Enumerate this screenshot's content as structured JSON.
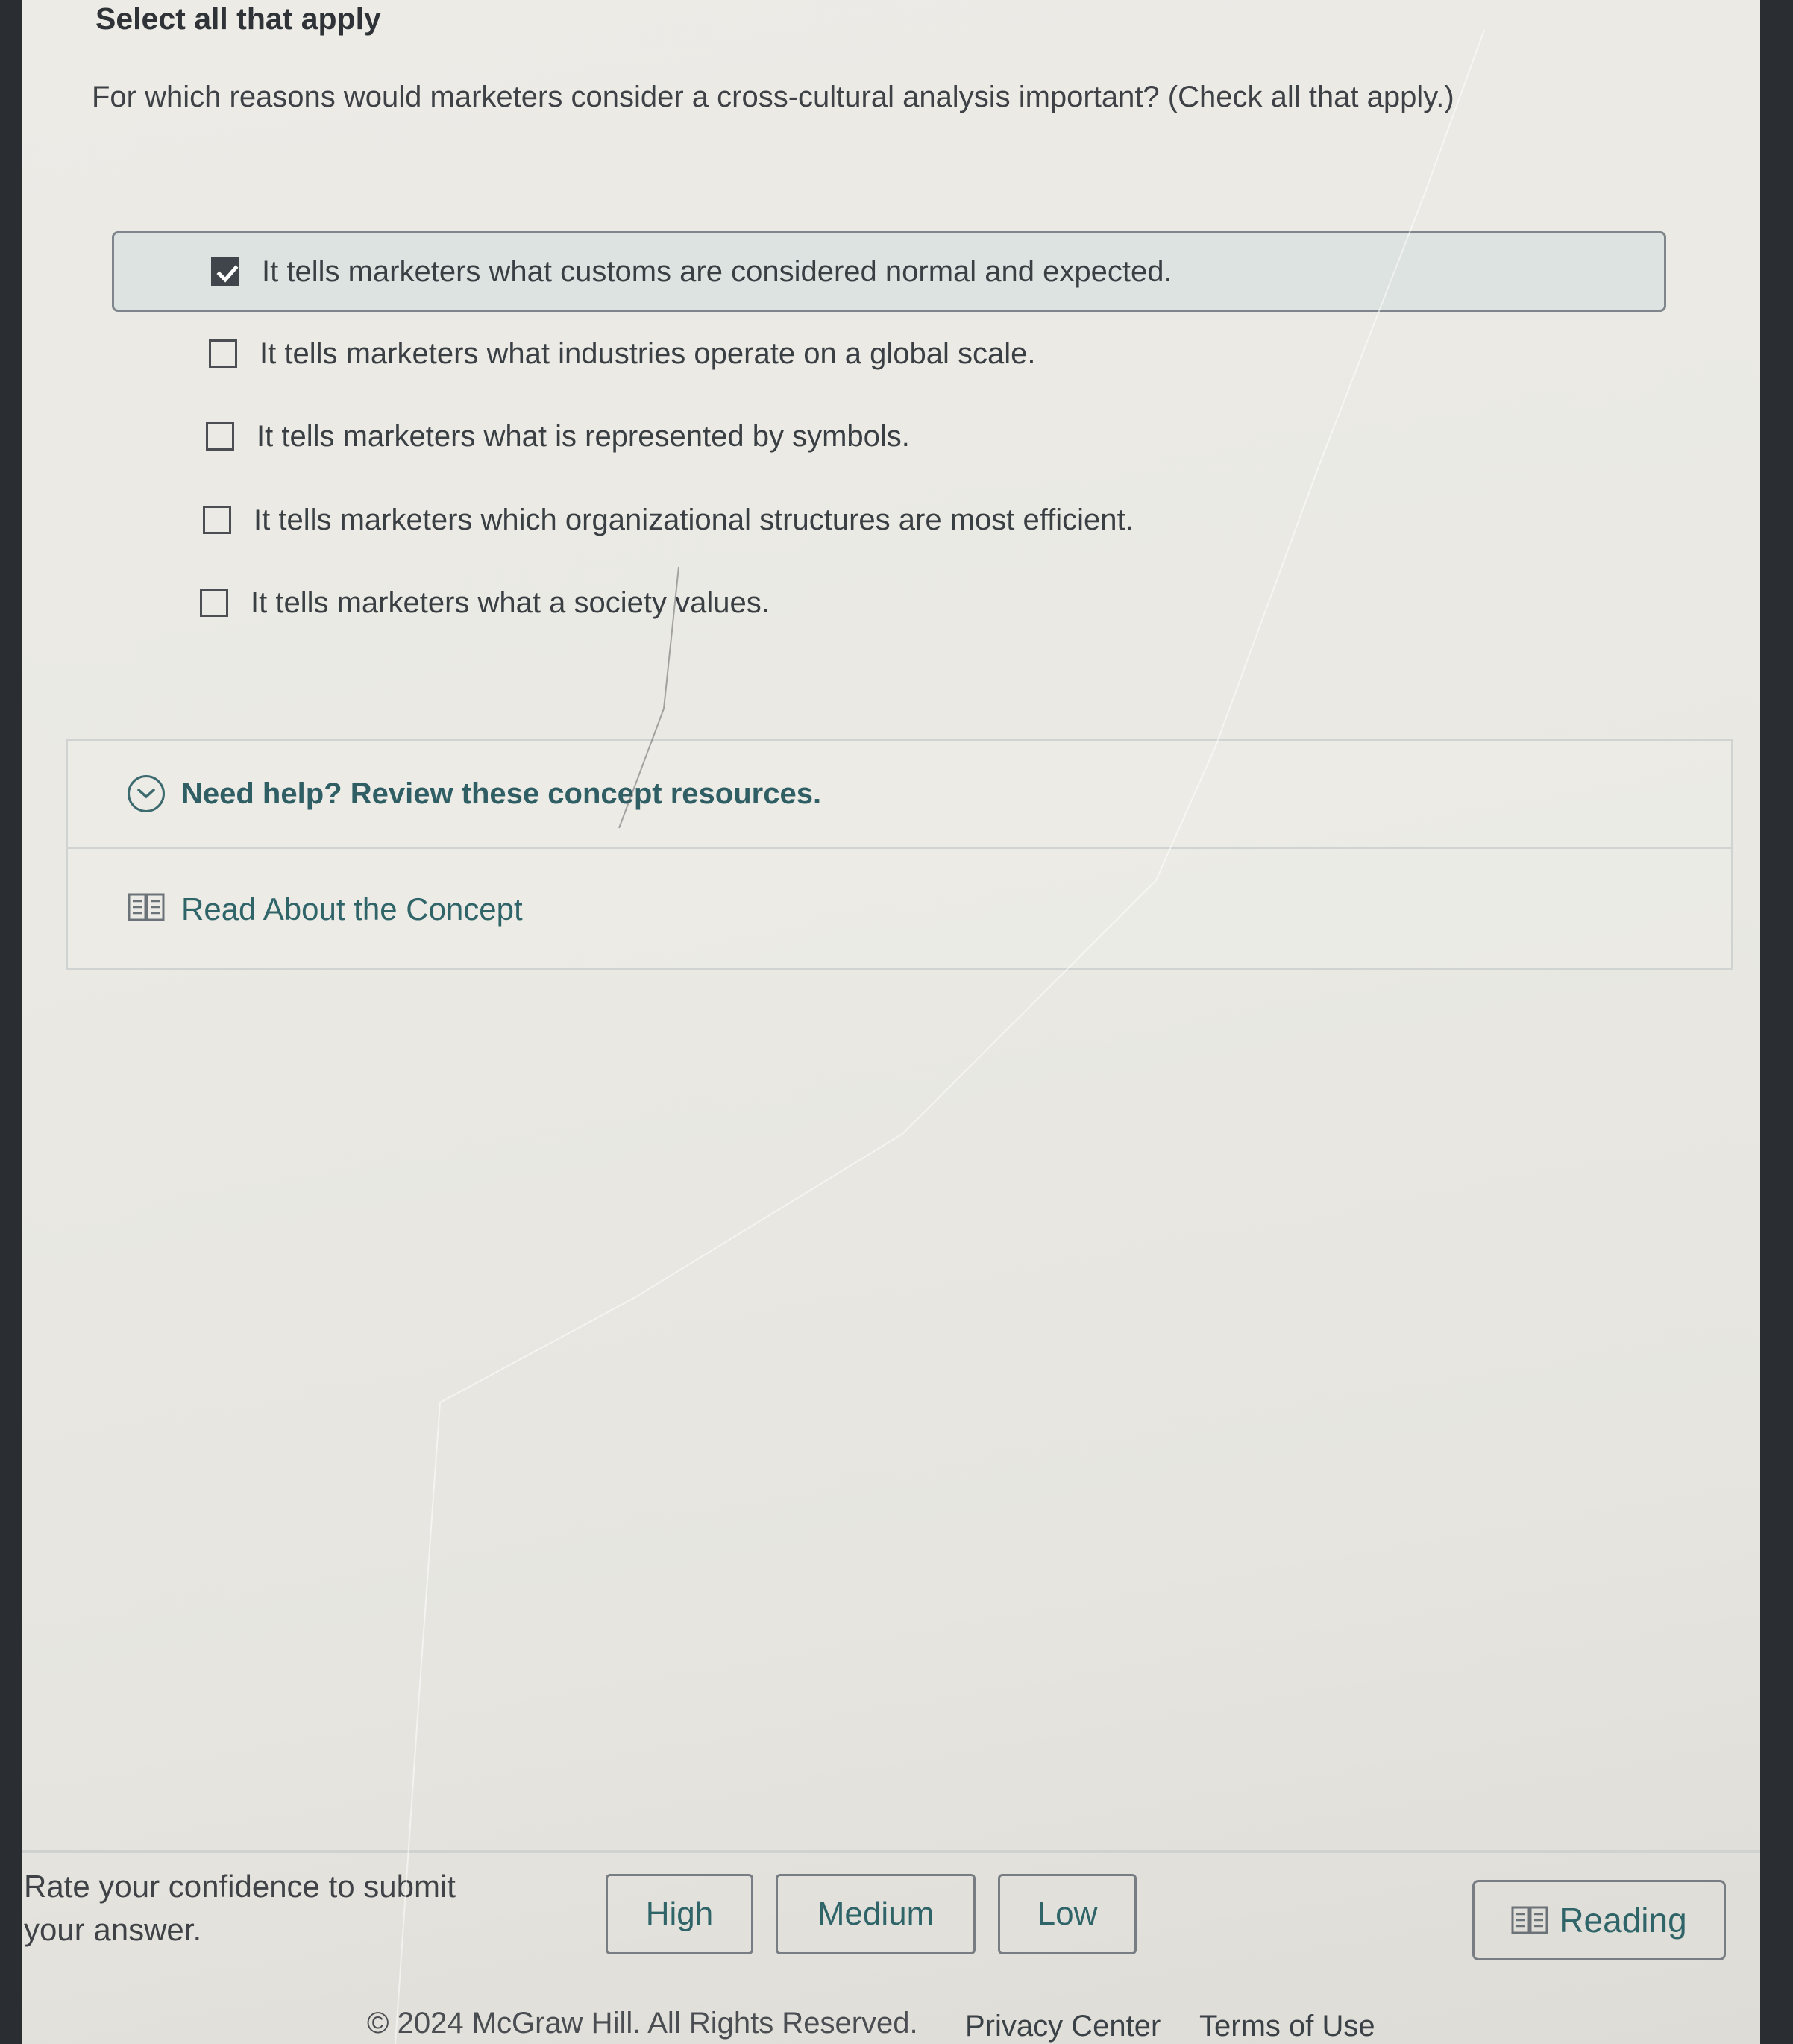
{
  "header": {
    "instruction": "Select all that apply"
  },
  "question": {
    "text": "For which reasons would marketers consider a cross-cultural analysis important? (Check all that apply.)"
  },
  "options": [
    {
      "label": "It tells marketers what customs are considered normal and expected.",
      "checked": true
    },
    {
      "label": "It tells marketers what industries operate on a global scale.",
      "checked": false
    },
    {
      "label": "It tells marketers what is represented by symbols.",
      "checked": false
    },
    {
      "label": "It tells marketers which organizational structures are most efficient.",
      "checked": false
    },
    {
      "label": "It tells marketers what a society values.",
      "checked": false
    }
  ],
  "help": {
    "toggle_label": "Need help? Review these concept resources.",
    "resource_label": "Read About the Concept"
  },
  "confidence": {
    "prompt": "Rate your confidence to submit your answer.",
    "buttons": [
      "High",
      "Medium",
      "Low"
    ]
  },
  "reading_button": "Reading",
  "footer": {
    "copyright": "© 2024 McGraw Hill. All Rights Reserved.",
    "privacy": "Privacy Center",
    "terms": "Terms of Use"
  },
  "colors": {
    "accent": "#2f6469",
    "selected_bg": "#dde3e1",
    "checkbox_checked": "#3f454a"
  },
  "icons": [
    "checkmark-icon",
    "chevron-down-circle-icon",
    "book-icon"
  ]
}
